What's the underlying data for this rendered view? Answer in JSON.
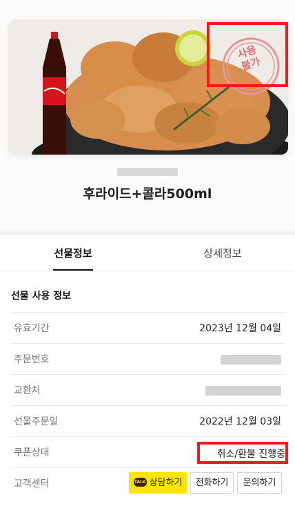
{
  "product": {
    "name": "후라이드+콜라500ml",
    "stamp": {
      "line1": "사용",
      "line2": "불가"
    }
  },
  "tabs": [
    {
      "label": "선물정보",
      "active": true
    },
    {
      "label": "상세정보",
      "active": false
    }
  ],
  "section": {
    "title": "선물 사용 정보",
    "rows": [
      {
        "label": "유효기간",
        "value": "2023년 12월 04일"
      },
      {
        "label": "주문번호",
        "value": ""
      },
      {
        "label": "교환처",
        "value": ""
      },
      {
        "label": "선물주문일",
        "value": "2022년 12월 03일"
      },
      {
        "label": "쿠폰상태",
        "value": "취소/환불 진행중"
      },
      {
        "label": "고객센터",
        "value": ""
      }
    ]
  },
  "buttons": {
    "kakao_badge": "TALK",
    "kakao": "상담하기",
    "call": "전화하기",
    "inquiry": "문의하기"
  },
  "colors": {
    "highlight": "#ee1c1c",
    "kakao_yellow": "#fee500",
    "stamp": "#e07276"
  }
}
